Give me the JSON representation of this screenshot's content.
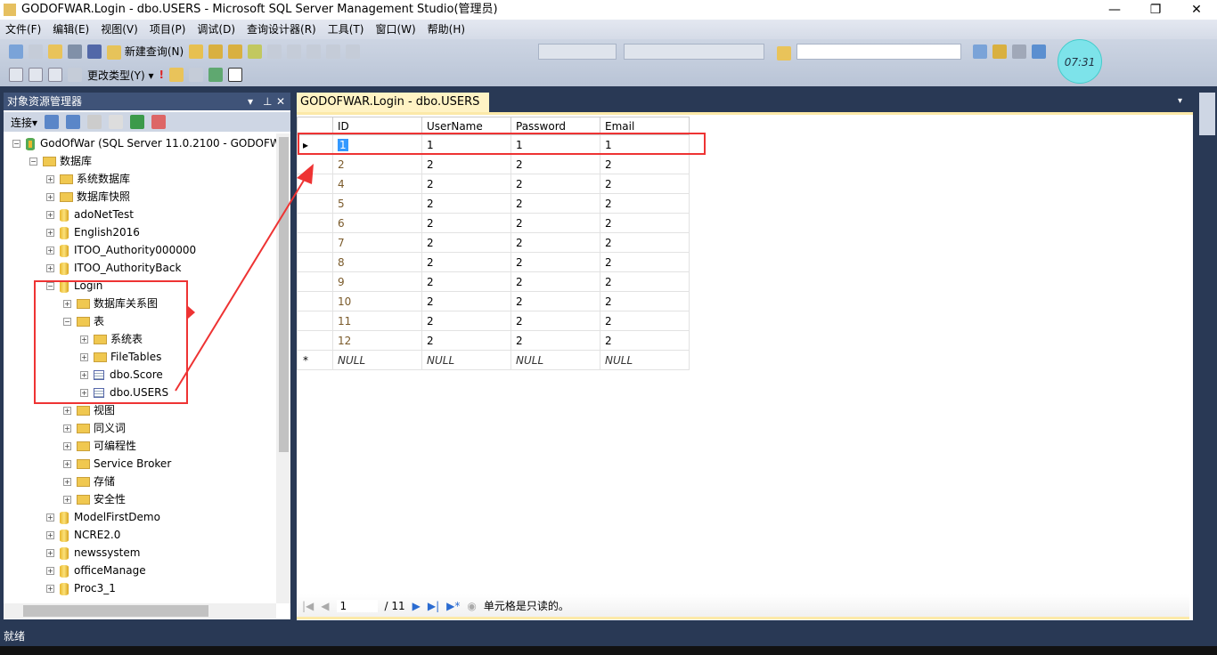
{
  "window": {
    "title": "GODOFWAR.Login - dbo.USERS - Microsoft SQL Server Management Studio(管理员)"
  },
  "menu": [
    "文件(F)",
    "编辑(E)",
    "视图(V)",
    "项目(P)",
    "调试(D)",
    "查询设计器(R)",
    "工具(T)",
    "窗口(W)",
    "帮助(H)"
  ],
  "toolbar": {
    "new_query": "新建查询(N)",
    "change_type": "更改类型(Y)",
    "clock": "07:31"
  },
  "object_explorer": {
    "title": "对象资源管理器",
    "connect": "连接",
    "nodes": [
      {
        "label": "GodOfWar (SQL Server 11.0.2100 - GODOFW",
        "level": 0,
        "type": "server",
        "expanded": true
      },
      {
        "label": "数据库",
        "level": 1,
        "type": "folder",
        "expanded": true
      },
      {
        "label": "系统数据库",
        "level": 2,
        "type": "folder"
      },
      {
        "label": "数据库快照",
        "level": 2,
        "type": "folder"
      },
      {
        "label": "adoNetTest",
        "level": 2,
        "type": "db"
      },
      {
        "label": "English2016",
        "level": 2,
        "type": "db"
      },
      {
        "label": "ITOO_Authority000000",
        "level": 2,
        "type": "db"
      },
      {
        "label": "ITOO_AuthorityBack",
        "level": 2,
        "type": "db"
      },
      {
        "label": "Login",
        "level": 2,
        "type": "db",
        "expanded": true
      },
      {
        "label": "数据库关系图",
        "level": 3,
        "type": "folder"
      },
      {
        "label": "表",
        "level": 3,
        "type": "folder",
        "expanded": true
      },
      {
        "label": "系统表",
        "level": 4,
        "type": "folder"
      },
      {
        "label": "FileTables",
        "level": 4,
        "type": "folder"
      },
      {
        "label": "dbo.Score",
        "level": 4,
        "type": "table"
      },
      {
        "label": "dbo.USERS",
        "level": 4,
        "type": "table"
      },
      {
        "label": "视图",
        "level": 3,
        "type": "folder"
      },
      {
        "label": "同义词",
        "level": 3,
        "type": "folder"
      },
      {
        "label": "可编程性",
        "level": 3,
        "type": "folder"
      },
      {
        "label": "Service Broker",
        "level": 3,
        "type": "folder"
      },
      {
        "label": "存储",
        "level": 3,
        "type": "folder"
      },
      {
        "label": "安全性",
        "level": 3,
        "type": "folder"
      },
      {
        "label": "ModelFirstDemo",
        "level": 2,
        "type": "db"
      },
      {
        "label": "NCRE2.0",
        "level": 2,
        "type": "db"
      },
      {
        "label": "newssystem",
        "level": 2,
        "type": "db"
      },
      {
        "label": "officeManage",
        "level": 2,
        "type": "db"
      },
      {
        "label": "Proc3_1",
        "level": 2,
        "type": "db"
      }
    ]
  },
  "document": {
    "tab": "GODOFWAR.Login - dbo.USERS",
    "columns": [
      "ID",
      "UserName",
      "Password",
      "Email"
    ],
    "rows": [
      [
        "1",
        "1",
        "1",
        "1"
      ],
      [
        "2",
        "2",
        "2",
        "2"
      ],
      [
        "4",
        "2",
        "2",
        "2"
      ],
      [
        "5",
        "2",
        "2",
        "2"
      ],
      [
        "6",
        "2",
        "2",
        "2"
      ],
      [
        "7",
        "2",
        "2",
        "2"
      ],
      [
        "8",
        "2",
        "2",
        "2"
      ],
      [
        "9",
        "2",
        "2",
        "2"
      ],
      [
        "10",
        "2",
        "2",
        "2"
      ],
      [
        "11",
        "2",
        "2",
        "2"
      ],
      [
        "12",
        "2",
        "2",
        "2"
      ]
    ],
    "new_row": [
      "NULL",
      "NULL",
      "NULL",
      "NULL"
    ],
    "nav": {
      "current": "1",
      "total": "/ 11",
      "message": "单元格是只读的。"
    }
  },
  "status": "就绪",
  "colors": {
    "annotation": "#e33333",
    "frame": "#293955"
  }
}
